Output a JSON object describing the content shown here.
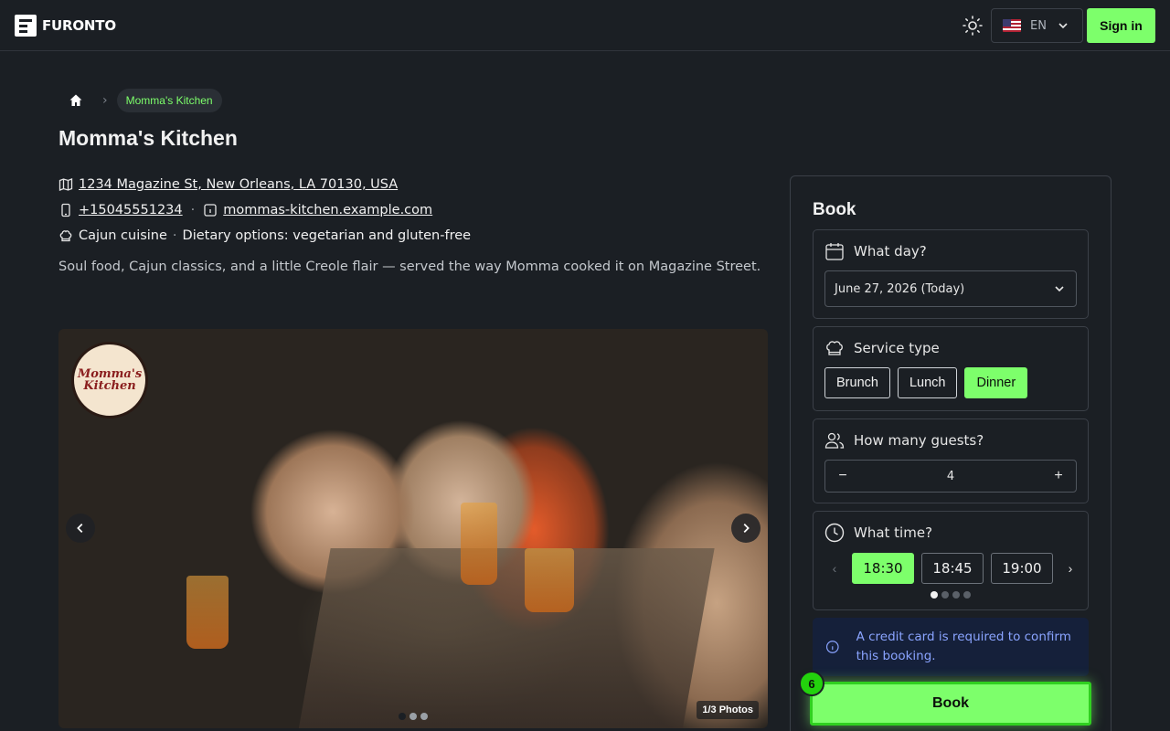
{
  "brand": {
    "name": "FURONTO"
  },
  "header": {
    "language_code": "EN",
    "signin_label": "Sign in"
  },
  "breadcrumb": {
    "current": "Momma's Kitchen"
  },
  "restaurant": {
    "name": "Momma's Kitchen",
    "address": "1234 Magazine St, New Orleans, LA 70130, USA",
    "phone": "+15045551234",
    "website": "mommas-kitchen.example.com",
    "cuisine": "Cajun cuisine",
    "dietary": "Dietary options: vegetarian and gluten-free",
    "description": "Soul food, Cajun classics, and a little Creole flair — served the way Momma cooked it on Magazine Street."
  },
  "gallery": {
    "logo_text": "Momma's Kitchen",
    "counter": "1/3 Photos",
    "dots_count": 3,
    "active_index": 0
  },
  "booking": {
    "title": "Book",
    "day": {
      "label": "What day?",
      "value": "June 27, 2026 (Today)"
    },
    "service": {
      "label": "Service type",
      "options": [
        "Brunch",
        "Lunch",
        "Dinner"
      ],
      "selected": "Dinner"
    },
    "guests": {
      "label": "How many guests?",
      "minus": "−",
      "plus": "+",
      "value": "4"
    },
    "time": {
      "label": "What time?",
      "slots": [
        "18:30",
        "18:45",
        "19:00"
      ],
      "selected": "18:30",
      "pages": 4,
      "active_page": 0
    },
    "notice": "A credit card is required to confirm this booking.",
    "submit_label": "Book",
    "step_badge": "6"
  },
  "colors": {
    "accent": "#7dff6b",
    "background": "#1b1f24",
    "notice_text": "#8aa4ff"
  }
}
